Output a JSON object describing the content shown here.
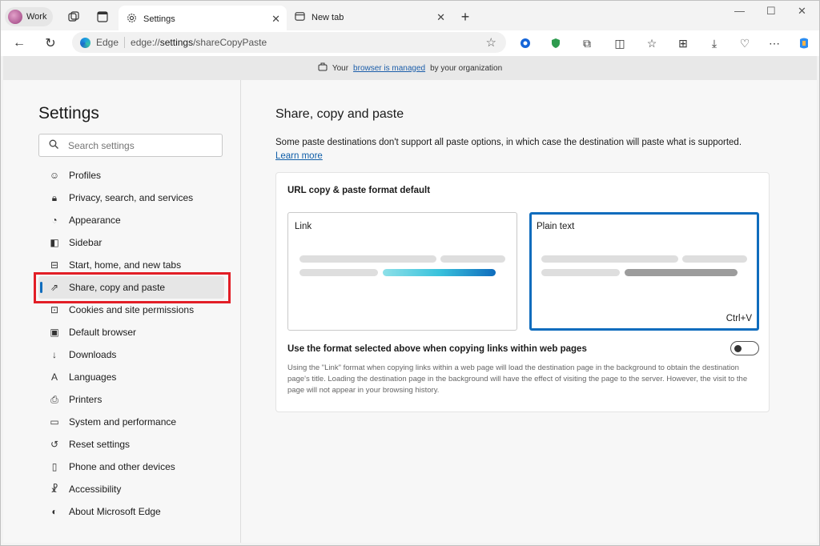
{
  "profile": {
    "label": "Work"
  },
  "tabs": [
    {
      "label": "Settings",
      "active": true
    },
    {
      "label": "New tab",
      "active": false
    }
  ],
  "address": {
    "brand": "Edge",
    "url_prefix": "edge://",
    "url_host": "settings",
    "url_path": "/shareCopyPaste"
  },
  "banner": {
    "prefix": "Your",
    "link": "browser is managed",
    "suffix": "by your organization"
  },
  "sidebar": {
    "title": "Settings",
    "search_placeholder": "Search settings",
    "items": [
      {
        "label": "Profiles",
        "icon": "profile-icon"
      },
      {
        "label": "Privacy, search, and services",
        "icon": "lock-icon"
      },
      {
        "label": "Appearance",
        "icon": "palette-icon"
      },
      {
        "label": "Sidebar",
        "icon": "sidebar-icon"
      },
      {
        "label": "Start, home, and new tabs",
        "icon": "home-icon"
      },
      {
        "label": "Share, copy and paste",
        "icon": "share-icon",
        "active": true
      },
      {
        "label": "Cookies and site permissions",
        "icon": "cookie-icon"
      },
      {
        "label": "Default browser",
        "icon": "browser-icon"
      },
      {
        "label": "Downloads",
        "icon": "download-icon"
      },
      {
        "label": "Languages",
        "icon": "language-icon"
      },
      {
        "label": "Printers",
        "icon": "printer-icon"
      },
      {
        "label": "System and performance",
        "icon": "laptop-icon"
      },
      {
        "label": "Reset settings",
        "icon": "reset-icon"
      },
      {
        "label": "Phone and other devices",
        "icon": "phone-icon"
      },
      {
        "label": "Accessibility",
        "icon": "accessibility-icon"
      },
      {
        "label": "About Microsoft Edge",
        "icon": "edge-logo-icon"
      }
    ]
  },
  "main": {
    "title": "Share, copy and paste",
    "description": "Some paste destinations don't support all paste options, in which case the destination will paste what is supported.",
    "learn_more": "Learn more",
    "card": {
      "title": "URL copy & paste format default",
      "option_link": "Link",
      "option_plain": "Plain text",
      "selected": "Plain text",
      "shortcut": "Ctrl+V",
      "toggle_label": "Use the format selected above when copying links within web pages",
      "toggle_on": false,
      "help": "Using the \"Link\" format when copying links within a web page will load the destination page in the background to obtain the destination page's title. Loading the destination page in the background will have the effect of visiting the page to the server. However, the visit to the page will not appear in your browsing history."
    }
  },
  "colors": {
    "accent": "#0f6cbd",
    "highlight_box": "#e21e26"
  }
}
